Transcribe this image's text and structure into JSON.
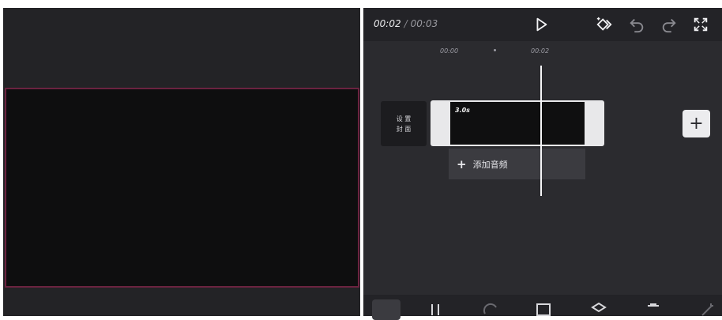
{
  "player": {
    "current_time": "00:02",
    "separator": "/",
    "total_time": "00:03"
  },
  "toolbar": {
    "icons": [
      "play-icon",
      "keyframe-icon",
      "undo-icon",
      "redo-icon",
      "fullscreen-icon"
    ]
  },
  "ruler": {
    "ticks": [
      "00:00",
      "00:02"
    ]
  },
  "timeline": {
    "cover_line1": "设 置",
    "cover_line2": "封 面",
    "clip_duration": "3.0s",
    "add_audio_plus": "+",
    "add_audio_label": "添加音频",
    "add_clip_label": "+"
  },
  "colors": {
    "selection_border": "#6b2340",
    "panel_bg": "#2b2b2f",
    "preview_bg": "#232326"
  },
  "bottom_toolbar": {
    "icons": [
      "split-icon",
      "speed-icon",
      "animation-icon",
      "layer-icon",
      "delete-icon",
      "magic-icon"
    ]
  }
}
